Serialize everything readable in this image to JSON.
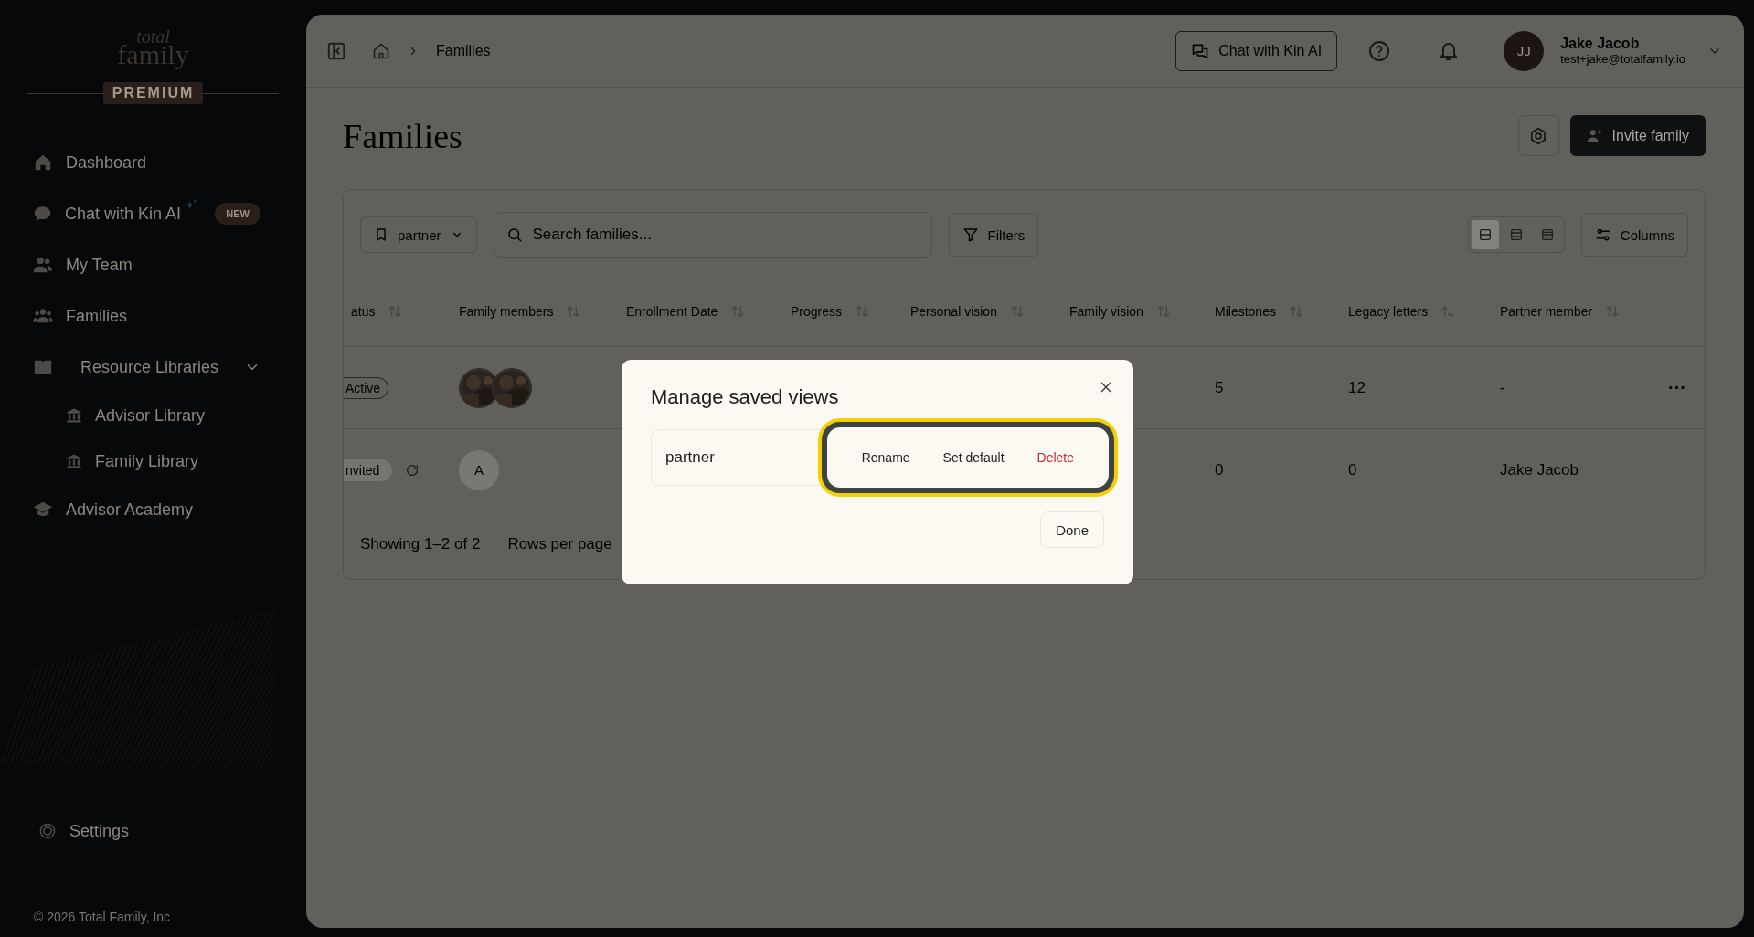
{
  "sidebar": {
    "logo": {
      "top": "total",
      "bottom": "family"
    },
    "plan": "PREMIUM",
    "items": [
      {
        "kind": "nav",
        "label": "Dashboard"
      },
      {
        "kind": "nav",
        "label": "Chat with Kin AI",
        "badge": "NEW"
      },
      {
        "kind": "nav",
        "label": "My Team"
      },
      {
        "kind": "nav",
        "label": "Families"
      },
      {
        "kind": "group",
        "label": "Resource Libraries",
        "expanded": true,
        "children": [
          {
            "label": "Advisor Library"
          },
          {
            "label": "Family Library"
          }
        ]
      },
      {
        "kind": "nav",
        "label": "Advisor Academy"
      }
    ],
    "settings": "Settings",
    "copyright": "© 2026 Total Family, Inc"
  },
  "header": {
    "breadcrumb": [
      "Families"
    ],
    "chat_button": "Chat with Kin AI",
    "user": {
      "initials": "JJ",
      "name": "Jake Jacob",
      "email": "test+jake@totalfamily.io"
    }
  },
  "page": {
    "title": "Families",
    "invite_button": "Invite family"
  },
  "toolbar": {
    "saved_view": "partner",
    "search": {
      "placeholder": "Search families..."
    },
    "filters": "Filters",
    "view_modes": [
      {
        "selected": true
      },
      {
        "selected": false
      },
      {
        "selected": false
      }
    ],
    "columns": "Columns"
  },
  "table": {
    "columns": [
      "atus",
      "Family members",
      "Enrollment Date",
      "Progress",
      "Personal vision",
      "Family vision",
      "Milestones",
      "Legacy letters",
      "Partner member"
    ],
    "rows": [
      {
        "status": "Active",
        "kind": "active",
        "milestones": "5",
        "legacy": "12",
        "partner": "-",
        "menu": "···"
      },
      {
        "status": "nvited",
        "kind": "invited",
        "members": [
          {
            "kind": "initial",
            "text": "A"
          }
        ],
        "milestones": "0",
        "legacy": "0",
        "partner": "Jake Jacob"
      }
    ],
    "footer": {
      "showing": "Showing 1–2 of 2",
      "rows_per_page": "Rows per page"
    }
  },
  "dialog": {
    "title": "Manage saved views",
    "views": [
      {
        "name": "partner",
        "actions": [
          {
            "kind": "normal",
            "label": "Rename"
          },
          {
            "kind": "normal",
            "label": "Set default"
          },
          {
            "kind": "danger",
            "label": "Delete"
          }
        ],
        "highlighted": true
      }
    ],
    "done": "Done"
  }
}
